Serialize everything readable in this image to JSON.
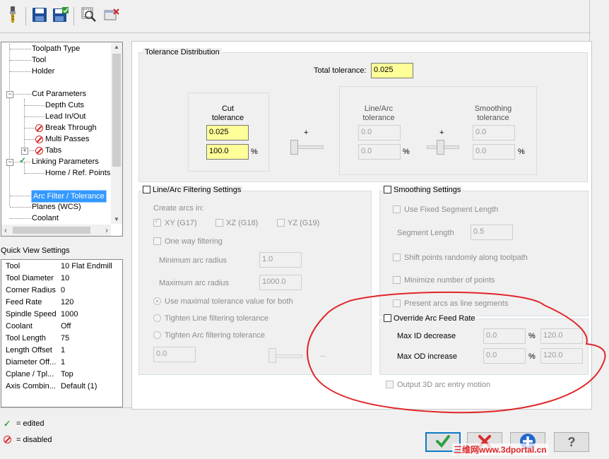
{
  "toolbar": {
    "icons": [
      "tool-icon",
      "save-icon",
      "save-as-icon",
      "preview-icon",
      "cancel-changes-icon"
    ]
  },
  "tree": {
    "items": [
      {
        "label": "Toolpath Type"
      },
      {
        "label": "Tool"
      },
      {
        "label": "Holder"
      },
      {
        "label": "Cut Parameters"
      },
      {
        "label": "Depth Cuts"
      },
      {
        "label": "Lead In/Out"
      },
      {
        "label": "Break Through"
      },
      {
        "label": "Multi Passes"
      },
      {
        "label": "Tabs"
      },
      {
        "label": "Linking Parameters"
      },
      {
        "label": "Home / Ref. Points"
      },
      {
        "label": "Arc Filter / Tolerance"
      },
      {
        "label": "Planes (WCS)"
      },
      {
        "label": "Coolant"
      }
    ]
  },
  "quick_view": {
    "title": "Quick View Settings",
    "rows": [
      {
        "key": "Tool",
        "value": "10 Flat Endmill"
      },
      {
        "key": "Tool Diameter",
        "value": "10"
      },
      {
        "key": "Corner Radius",
        "value": "0"
      },
      {
        "key": "Feed Rate",
        "value": "120"
      },
      {
        "key": "Spindle Speed",
        "value": "1000"
      },
      {
        "key": "Coolant",
        "value": "Off"
      },
      {
        "key": "Tool Length",
        "value": "75"
      },
      {
        "key": "Length Offset",
        "value": "1"
      },
      {
        "key": "Diameter Off...",
        "value": "1"
      },
      {
        "key": "Cplane / Tpl...",
        "value": "Top"
      },
      {
        "key": "Axis Combin...",
        "value": "Default (1)"
      }
    ]
  },
  "legend": {
    "edited": "= edited",
    "disabled": "= disabled"
  },
  "tolerance": {
    "title": "Tolerance Distribution",
    "total_label": "Total tolerance:",
    "total_value": "0.025",
    "cut_label": "Cut\ntolerance",
    "cut_value": "0.025",
    "cut_percent": "100.0",
    "linearc_label": "Line/Arc\ntolerance",
    "linearc_value": "0.0",
    "linearc_percent": "0.0",
    "smoothing_label": "Smoothing\ntolerance",
    "smoothing_value": "0.0",
    "smoothing_percent": "0.0",
    "plus": "+",
    "pct": "%"
  },
  "linearc_filter": {
    "title": "Line/Arc Filtering Settings",
    "create_arcs_label": "Create arcs in:",
    "xy": "XY (G17)",
    "xz": "XZ (G18)",
    "yz": "YZ (G19)",
    "one_way": "One way filtering",
    "min_radius_label": "Minimum arc radius",
    "min_radius_value": "1.0",
    "max_radius_label": "Maximum arc radius",
    "max_radius_value": "1000.0",
    "opt_max_tol": "Use maximal tolerance value for both",
    "opt_tighten_line": "Tighten Line filtering tolerance",
    "opt_tighten_arc": "Tighten Arc filtering tolerance",
    "tighten_value": "0.0",
    "ellipsis": "..."
  },
  "smoothing": {
    "title": "Smoothing Settings",
    "fixed_seg": "Use Fixed Segment Length",
    "seg_len_label": "Segment Length",
    "seg_len_value": "0.5",
    "shift_points": "Shift points randomly along toolpath",
    "minimize": "Minimize number of points",
    "present_arcs": "Present arcs as line segments"
  },
  "override": {
    "title": "Override Arc Feed Rate",
    "max_id_label": "Max ID decrease",
    "max_id_value": "0.0",
    "max_id_result": "120.0",
    "max_od_label": "Max OD increase",
    "max_od_value": "0.0",
    "max_od_result": "120.0",
    "pct": "%"
  },
  "output_3d": "Output 3D arc entry motion",
  "watermark": "三维网www.3dportal.cn",
  "colors": {
    "annotation": "#e0262a",
    "field_yellow": "#ffff99",
    "ok_green": "#2ea043",
    "cancel_red": "#d62b2b",
    "add_blue": "#2266cc"
  }
}
